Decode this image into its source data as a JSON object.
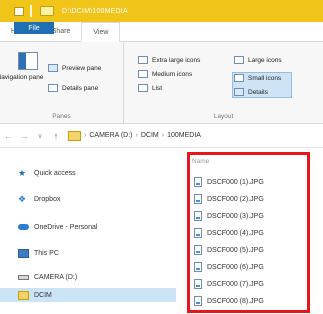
{
  "window": {
    "title": "D:\\DCIM\\100MEDIA"
  },
  "ribbon_tabs": [
    {
      "label": "File"
    },
    {
      "label": "Home"
    },
    {
      "label": "Share"
    },
    {
      "label": "View"
    }
  ],
  "ribbon": {
    "navigation_pane": "Navigation pane",
    "preview_pane": "Preview pane",
    "details_pane": "Details pane",
    "panes_group": "Panes",
    "extra_large_icons": "Extra large icons",
    "large_icons": "Large icons",
    "medium_icons": "Medium icons",
    "small_icons": "Small icons",
    "list": "List",
    "details": "Details",
    "layout_group": "Layout"
  },
  "address_bar": {
    "crumbs": [
      "CAMERA (D:)",
      "DCIM",
      "100MEDIA"
    ]
  },
  "nav_pane": {
    "items": [
      {
        "label": "Quick access",
        "icon": "star-icon",
        "color": "#1f6fb5"
      },
      {
        "label": "Dropbox",
        "icon": "dropbox-icon",
        "color": "#2a7fd4"
      },
      {
        "label": "OneDrive - Personal",
        "icon": "cloud-icon",
        "color": "#2a7fd4"
      },
      {
        "label": "This PC",
        "icon": "computer-icon",
        "color": "#3b7dc4"
      },
      {
        "label": "CAMERA (D:)",
        "icon": "drive-icon",
        "color": "#666666"
      },
      {
        "label": "DCIM",
        "icon": "folder-icon",
        "color": "#f6d36a"
      }
    ]
  },
  "file_list": {
    "column_header": "Name",
    "files": [
      "DSCF000 (1).JPG",
      "DSCF000 (2).JPG",
      "DSCF000 (3).JPG",
      "DSCF000 (4).JPG",
      "DSCF000 (5).JPG",
      "DSCF000 (6).JPG",
      "DSCF000 (7).JPG",
      "DSCF000 (8).JPG"
    ]
  },
  "colors": {
    "title_bar": "#f0c419",
    "file_tab": "#1f6fb5",
    "selection": "#cce4f7",
    "highlight_border": "#e8151c"
  }
}
